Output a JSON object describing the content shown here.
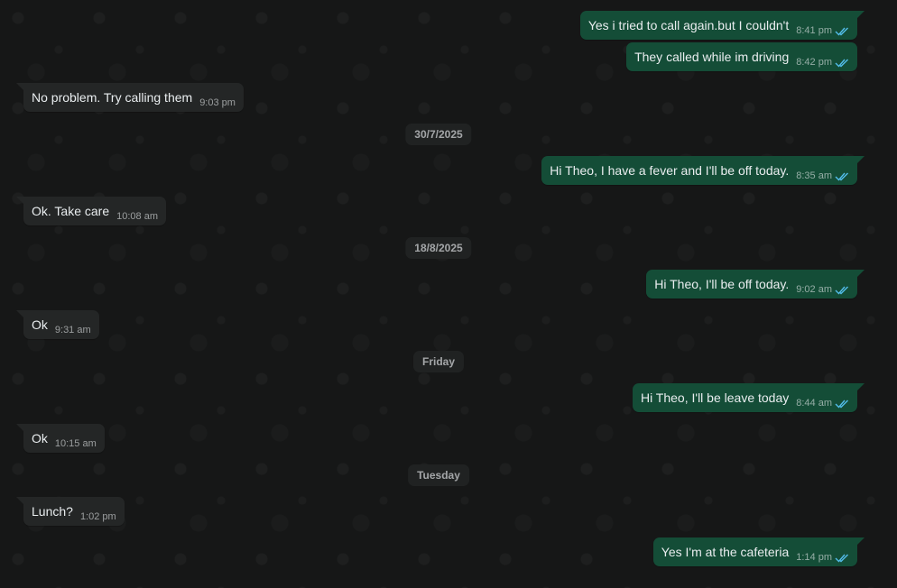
{
  "colors": {
    "background": "#161717",
    "outgoing_bubble": "#144d37",
    "incoming_bubble": "#242626",
    "read_ticks": "#53bdeb"
  },
  "messages": [
    {
      "direction": "out",
      "text": "Yes i tried to call again.but I couldn't",
      "time": "8:41 pm",
      "status": "read"
    },
    {
      "direction": "out",
      "text": "They called while im driving",
      "time": "8:42 pm",
      "status": "read"
    },
    {
      "direction": "in",
      "text": "No problem. Try calling them",
      "time": "9:03 pm"
    },
    {
      "date": "30/7/2025"
    },
    {
      "direction": "out",
      "text": "Hi Theo, I have a fever and I'll be off today.",
      "time": "8:35 am",
      "status": "read"
    },
    {
      "direction": "in",
      "text": "Ok. Take care",
      "time": "10:08 am"
    },
    {
      "date": "18/8/2025"
    },
    {
      "direction": "out",
      "text": "Hi Theo, I'll be off today.",
      "time": "9:02 am",
      "status": "read"
    },
    {
      "direction": "in",
      "text": "Ok",
      "time": "9:31 am"
    },
    {
      "date": "Friday"
    },
    {
      "direction": "out",
      "text": "Hi Theo, I'll be leave today",
      "time": "8:44 am",
      "status": "read"
    },
    {
      "direction": "in",
      "text": "Ok",
      "time": "10:15 am"
    },
    {
      "date": "Tuesday"
    },
    {
      "direction": "in",
      "text": "Lunch?",
      "time": "1:02 pm"
    },
    {
      "direction": "out",
      "text": "Yes I'm at the cafeteria",
      "time": "1:14 pm",
      "status": "read"
    }
  ]
}
